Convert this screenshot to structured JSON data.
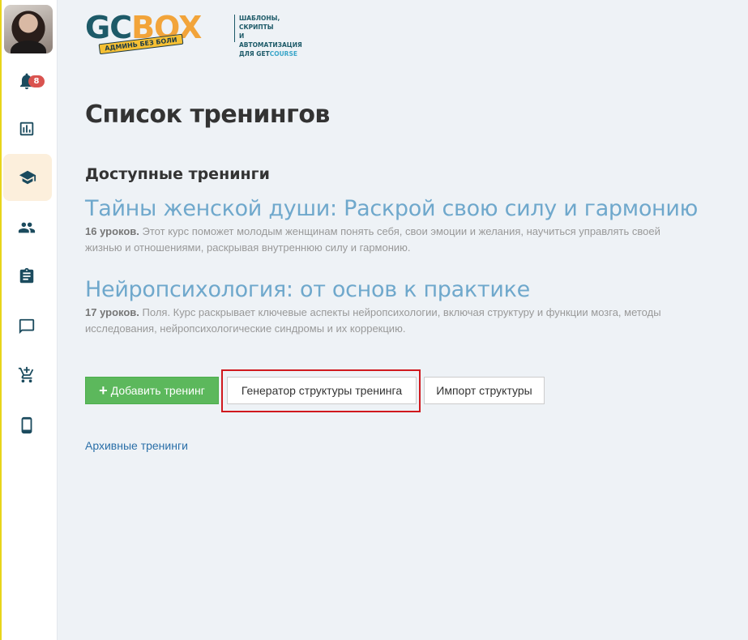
{
  "sidebar": {
    "avatar_alt": "user avatar",
    "notifications_count": "8",
    "items": [
      {
        "name": "notifications",
        "icon": "bell-icon"
      },
      {
        "name": "reports",
        "icon": "bar-chart-icon"
      },
      {
        "name": "trainings",
        "icon": "graduation-cap-icon",
        "active": true
      },
      {
        "name": "users",
        "icon": "users-icon"
      },
      {
        "name": "tasks",
        "icon": "clipboard-icon"
      },
      {
        "name": "messages",
        "icon": "chat-icon"
      },
      {
        "name": "sales",
        "icon": "cart-plus-icon"
      },
      {
        "name": "mobile",
        "icon": "phone-icon"
      }
    ]
  },
  "logo": {
    "gc": "GC",
    "box": "BOX",
    "ribbon": "АДМИНЬ БЕЗ БОЛИ",
    "tagline_1": "ШАБЛОНЫ, СКРИПТЫ",
    "tagline_2": "И АВТОМАТИЗАЦИЯ",
    "tagline_3_prefix": "ДЛЯ GET",
    "tagline_3_suffix": "COURSE"
  },
  "page": {
    "title": "Список тренингов",
    "section_title": "Доступные тренинги"
  },
  "trainings": [
    {
      "title": "Тайны женской души: Раскрой свою силу и гармонию",
      "lessons": "16 уроков.",
      "description": "Этот курс поможет молодым женщинам понять себя, свои эмоции и желания, научиться управлять своей жизнью и отношениями, раскрывая внутреннюю силу и гармонию."
    },
    {
      "title": "Нейропсихология: от основ к практике",
      "lessons": "17 уроков.",
      "description": "Поля. Курс раскрывает ключевые аспекты нейропсихологии, включая структуру и функции мозга, методы исследования, нейропсихологические синдромы и их коррекцию."
    }
  ],
  "buttons": {
    "add": "Добавить тренинг",
    "generator": "Генератор структуры тренинга",
    "import": "Импорт структуры"
  },
  "archive_link": "Архивные тренинги",
  "colors": {
    "accent_link": "#6fa8cc",
    "success": "#5cb85c",
    "highlight": "#d0191e",
    "active_nav_bg": "#fcefdc"
  }
}
